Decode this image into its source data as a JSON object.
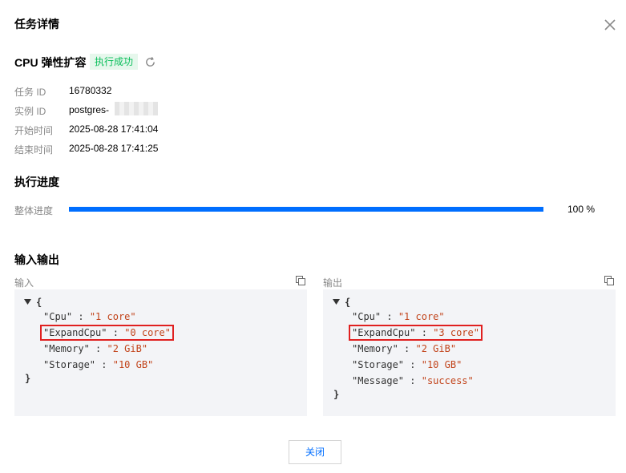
{
  "dialog": {
    "title": "任务详情"
  },
  "task": {
    "name": "CPU 弹性扩容",
    "status": "执行成功",
    "fields": [
      {
        "label": "任务 ID",
        "value": "16780332"
      },
      {
        "label": "实例 ID",
        "value": "postgres-"
      },
      {
        "label": "开始时间",
        "value": "2025-08-28 17:41:04"
      },
      {
        "label": "结束时间",
        "value": "2025-08-28 17:41:25"
      }
    ]
  },
  "progress": {
    "section_title": "执行进度",
    "label": "整体进度",
    "percent_text": "100 %",
    "fraction": 1.0
  },
  "io": {
    "section_title": "输入输出",
    "input": {
      "label": "输入",
      "entries": [
        {
          "key": "\"Cpu\"",
          "value": "\"1 core\""
        },
        {
          "key": "\"ExpandCpu\"",
          "value": "\"0 core\""
        },
        {
          "key": "\"Memory\"",
          "value": "\"2 GiB\""
        },
        {
          "key": "\"Storage\"",
          "value": "\"10 GB\""
        }
      ]
    },
    "output": {
      "label": "输出",
      "entries": [
        {
          "key": "\"Cpu\"",
          "value": "\"1 core\""
        },
        {
          "key": "\"ExpandCpu\"",
          "value": "\"3 core\""
        },
        {
          "key": "\"Memory\"",
          "value": "\"2 GiB\""
        },
        {
          "key": "\"Storage\"",
          "value": "\"10 GB\""
        },
        {
          "key": "\"Message\"",
          "value": "\"success\""
        }
      ]
    },
    "brace_open": "{",
    "brace_close": "}",
    "colon": ":"
  },
  "footer": {
    "close_label": "关闭"
  },
  "colors": {
    "accent": "#006eff",
    "success": "#0abf5b",
    "string": "#c2441b",
    "highlight": "#e02020"
  },
  "icons": [
    "close-icon",
    "refresh-icon",
    "copy-icon",
    "caret-down-icon"
  ]
}
